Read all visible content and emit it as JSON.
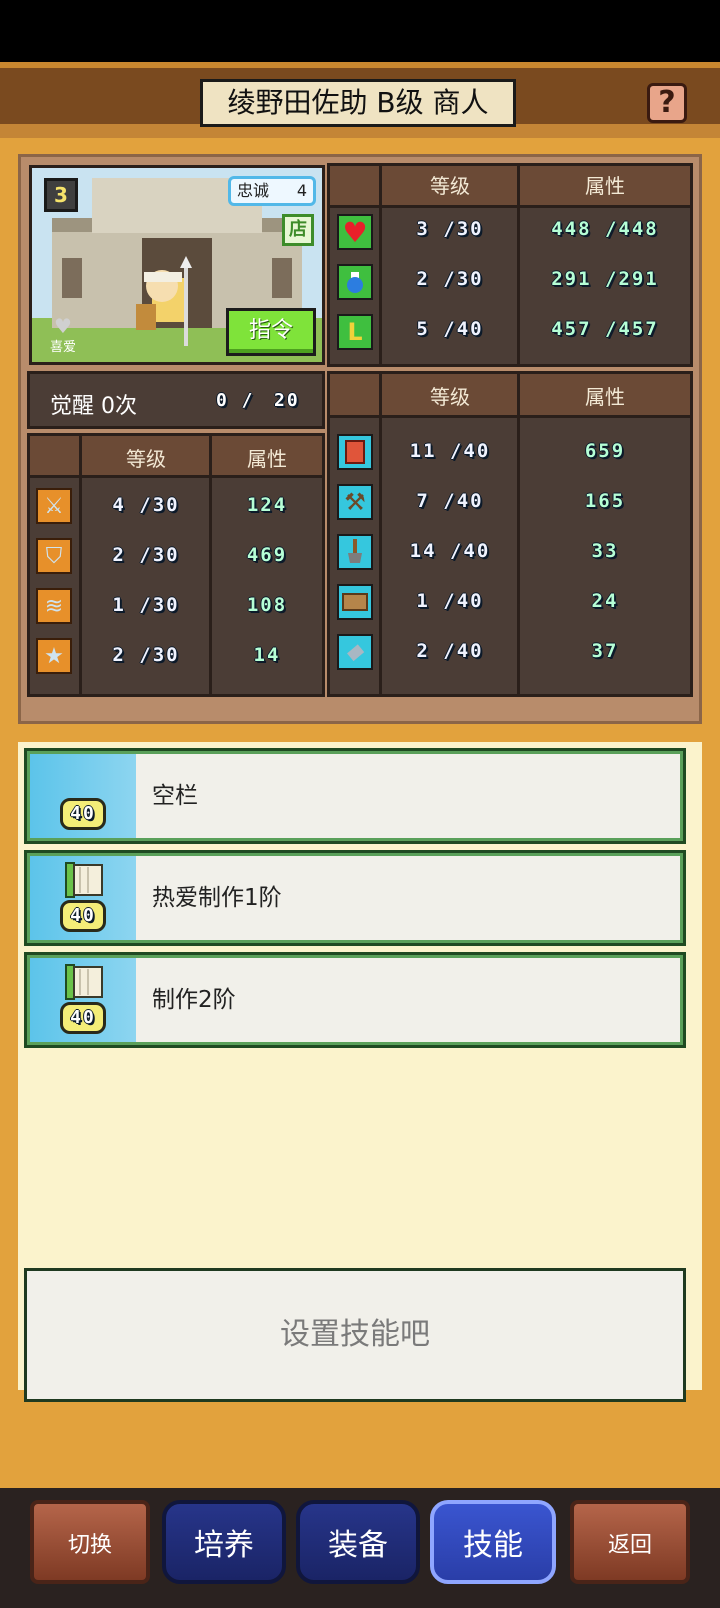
{
  "header": {
    "title": "绫野田佐助 B级 商人",
    "help_icon": "?"
  },
  "portrait": {
    "rank": "3",
    "loyalty_label": "忠诚",
    "loyalty_value": "4",
    "shop_badge": "店",
    "favorite_label": "喜爱",
    "command_button": "指令"
  },
  "vitals": {
    "headers": {
      "level": "等级",
      "attr": "属性"
    },
    "rows": [
      {
        "icon": "heart-icon",
        "level": "3 /30",
        "attr": "448 /448"
      },
      {
        "icon": "potion-icon",
        "level": "2 /30",
        "attr": "291 /291"
      },
      {
        "icon": "muscle-icon",
        "level": "5 /40",
        "attr": "457 /457"
      }
    ]
  },
  "awakening": {
    "label": "觉醒 0次",
    "progress": "0 /",
    "max": "20"
  },
  "combat": {
    "headers": {
      "level": "等级",
      "attr": "属性"
    },
    "rows": [
      {
        "icon": "sword-icon",
        "level": "4 /30",
        "attr": "124"
      },
      {
        "icon": "shield-icon",
        "level": "2 /30",
        "attr": "469"
      },
      {
        "icon": "speed-icon",
        "level": "1 /30",
        "attr": "108"
      },
      {
        "icon": "star-icon",
        "level": "2 /30",
        "attr": "14"
      }
    ]
  },
  "crafting": {
    "headers": {
      "level": "等级",
      "attr": "属性"
    },
    "rows": [
      {
        "icon": "book-icon",
        "level": "11 /40",
        "attr": "659"
      },
      {
        "icon": "hammer-icon",
        "level": "7 /40",
        "attr": "165"
      },
      {
        "icon": "shovel-icon",
        "level": "14 /40",
        "attr": "33"
      },
      {
        "icon": "chest-icon",
        "level": "1 /40",
        "attr": "24"
      },
      {
        "icon": "flask-icon",
        "level": "2 /40",
        "attr": "37"
      }
    ]
  },
  "skill_slots": [
    {
      "level": "40",
      "label": "空栏",
      "has_scroll": false
    },
    {
      "level": "40",
      "label": "热爱制作1阶",
      "has_scroll": true
    },
    {
      "level": "40",
      "label": "制作2阶",
      "has_scroll": true
    }
  ],
  "hint": "设置技能吧",
  "nav": {
    "switch": "切换",
    "train": "培养",
    "equip": "装备",
    "skill": "技能",
    "back": "返回"
  },
  "colors": {
    "accent_orange": "#e2a23d",
    "panel_dark": "#4b3d36",
    "command_green": "#7fe33a",
    "skill_blue": "#5cc4ea",
    "nav_active": "#3a55d0"
  }
}
